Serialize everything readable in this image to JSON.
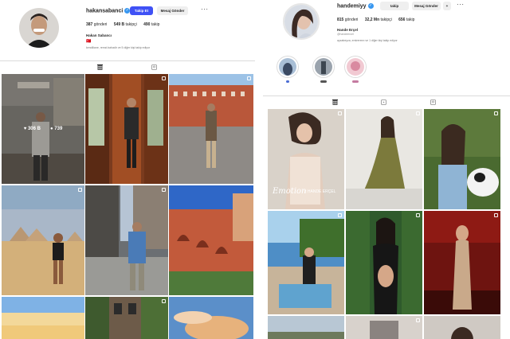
{
  "left_profile": {
    "username": "hakansabanci",
    "follow_label": "Takip Et",
    "message_label": "Mesaj Gönder",
    "more_label": "···",
    "posts_count": "387",
    "posts_label": "gönderi",
    "followers_count": "549 B",
    "followers_label": "takipçi",
    "following_count": "490",
    "following_label": "takip",
    "full_name": "Hakan Sabancı",
    "bio_flag": "🇹🇷",
    "followed_by": "kendiliane, remzi.bahadir ve 5 diğer kişi takip ediyor",
    "hover_likes": "306 B",
    "hover_comments": "739"
  },
  "right_profile": {
    "username": "handemiyy",
    "following_label": "takip",
    "message_label": "Mesaj Gönder",
    "add_label": "+",
    "more_label": "···",
    "posts_count": "815",
    "posts_label": "gönderi",
    "followers_count": "32,2 Mn",
    "followers_label": "takipçi",
    "following_count": "656",
    "full_name": "Hande Erçel",
    "handle": "@handeercel",
    "followed_by": "ayzabeyza, emirerenn ve 1 diğer kişi takip ediyor",
    "post_overlay_text": "Emotion",
    "post_overlay_brand": "x HANDE ERÇEL"
  },
  "icons": {
    "verified": "✓",
    "grid": "grid-icon",
    "tagged": "tagged-icon",
    "reels": "reels-icon"
  },
  "colors": {
    "accent": "#3f51f5",
    "verified": "#3897f0"
  }
}
